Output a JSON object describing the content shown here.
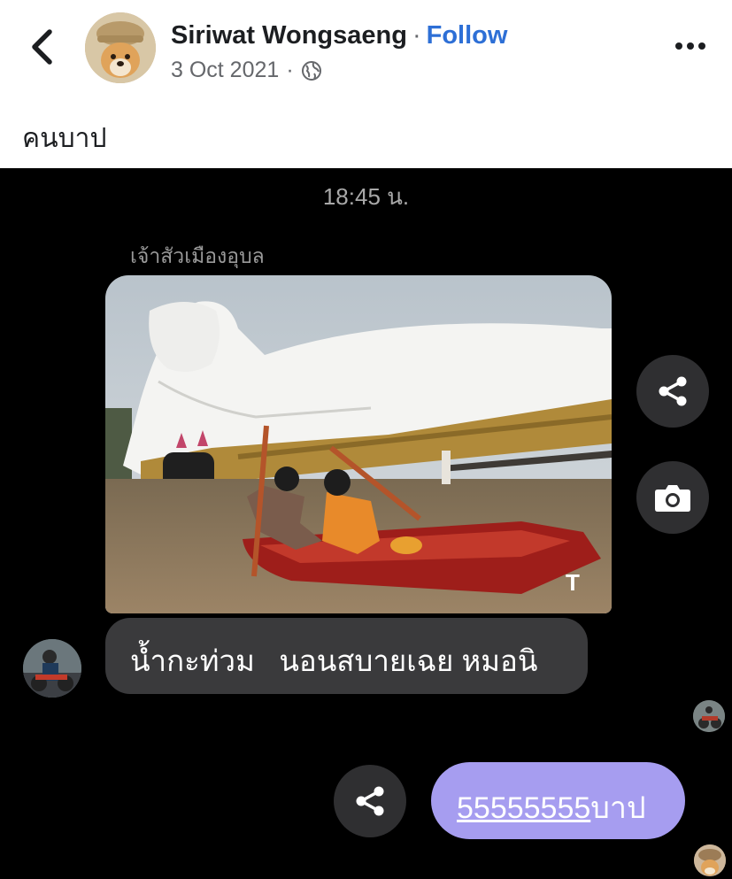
{
  "post": {
    "author": "Siriwat Wongsaeng",
    "separator": "·",
    "follow_label": "Follow",
    "date": "3 Oct 2021",
    "privacy_icon": "globe-icon",
    "caption": "คนบาป"
  },
  "chat": {
    "time": "18:45 น.",
    "sender_name": "เจ้าสัวเมืองอุบล",
    "photo_watermark": "T",
    "incoming_message": "น้ำกะท่วม   นอนสบายเฉย หมอนิ",
    "outgoing_link": "55555555",
    "outgoing_suffix": "บาป"
  },
  "colors": {
    "follow": "#2d6fd6",
    "chat_background": "#000000",
    "incoming_bubble": "#3a3a3c",
    "outgoing_bubble": "#a69df0"
  }
}
